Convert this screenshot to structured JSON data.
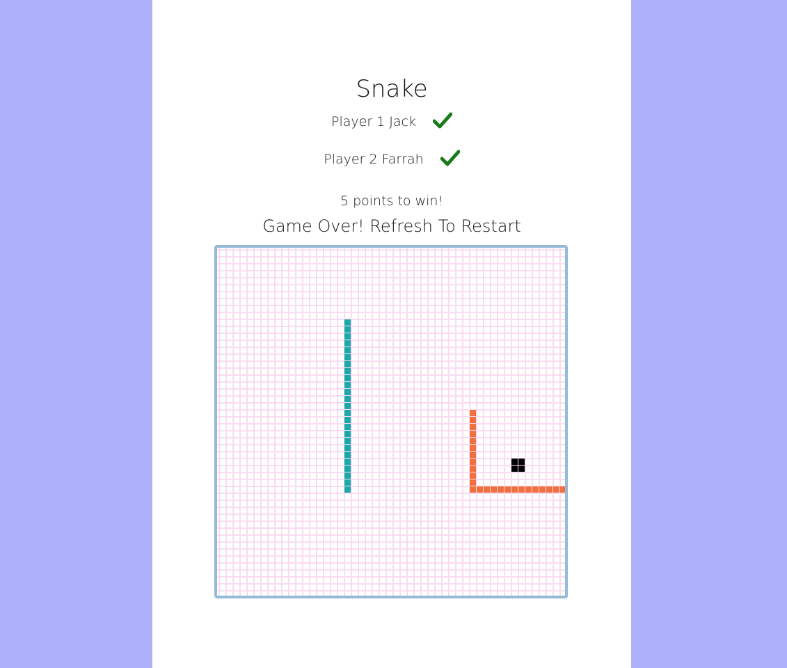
{
  "game": {
    "title": "Snake",
    "players": [
      {
        "label": "Player 1 Jack",
        "ready": true
      },
      {
        "label": "Player 2 Farrah",
        "ready": true
      }
    ],
    "win_text": "5 points to win!",
    "status_text": "Game Over! Refresh To Restart"
  },
  "board": {
    "columns": 50,
    "rows": 50,
    "grid_color": "#f9dcef",
    "border_color": "#93bad6"
  },
  "snakes": [
    {
      "color": "#1aa8aa",
      "cells": [
        [
          18,
          10
        ],
        [
          18,
          11
        ],
        [
          18,
          12
        ],
        [
          18,
          13
        ],
        [
          18,
          14
        ],
        [
          18,
          15
        ],
        [
          18,
          16
        ],
        [
          18,
          17
        ],
        [
          18,
          18
        ],
        [
          18,
          19
        ],
        [
          18,
          20
        ],
        [
          18,
          21
        ],
        [
          18,
          22
        ],
        [
          18,
          23
        ],
        [
          18,
          24
        ],
        [
          18,
          25
        ],
        [
          18,
          26
        ],
        [
          18,
          27
        ],
        [
          18,
          28
        ],
        [
          18,
          29
        ],
        [
          18,
          30
        ],
        [
          18,
          31
        ],
        [
          18,
          32
        ],
        [
          18,
          33
        ],
        [
          18,
          34
        ]
      ]
    },
    {
      "color": "#f07040",
      "cells": [
        [
          36,
          23
        ],
        [
          36,
          24
        ],
        [
          36,
          25
        ],
        [
          36,
          26
        ],
        [
          36,
          27
        ],
        [
          36,
          28
        ],
        [
          36,
          29
        ],
        [
          36,
          30
        ],
        [
          36,
          31
        ],
        [
          36,
          32
        ],
        [
          36,
          33
        ],
        [
          36,
          34
        ],
        [
          37,
          34
        ],
        [
          38,
          34
        ],
        [
          39,
          34
        ],
        [
          40,
          34
        ],
        [
          41,
          34
        ],
        [
          42,
          34
        ],
        [
          43,
          34
        ],
        [
          44,
          34
        ],
        [
          45,
          34
        ],
        [
          46,
          34
        ],
        [
          47,
          34
        ],
        [
          48,
          34
        ],
        [
          49,
          34
        ]
      ]
    }
  ],
  "food": {
    "color": "#000000",
    "cells": [
      [
        42,
        30
      ],
      [
        43,
        30
      ],
      [
        42,
        31
      ],
      [
        43,
        31
      ]
    ]
  },
  "colors": {
    "background": "#afb0fb",
    "panel": "#ffffff",
    "check": "#1a7a1a"
  }
}
